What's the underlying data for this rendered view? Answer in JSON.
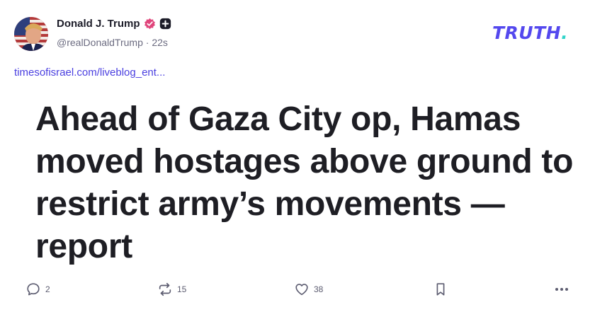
{
  "author": {
    "name": "Donald J. Trump",
    "handle": "@realDonaldTrump",
    "separator": "·",
    "time_ago": "22s"
  },
  "brand": {
    "logo_text": "TRUTH",
    "logo_dot": ".",
    "logo_color": "#5448ee",
    "accent_dot_color": "#2fd4c9"
  },
  "post": {
    "link_text": "timesofisrael.com/liveblog_ent...",
    "headline": "Ahead of Gaza City op, Hamas moved hostages above ground to restrict army’s movements — report"
  },
  "actions": {
    "reply_count": "2",
    "retruth_count": "15",
    "like_count": "38"
  },
  "icons": {
    "verified": "verified-badge-icon",
    "plus": "plus-badge-icon",
    "reply": "speech-bubble-icon",
    "retruth": "repost-arrows-icon",
    "like": "heart-icon",
    "save": "bookmark-icon",
    "more": "ellipsis-icon"
  },
  "colors": {
    "link": "#4a3fe0",
    "verified_badge": "#e0457b",
    "text_primary": "#1c1c28",
    "text_secondary": "#6b6b80"
  }
}
